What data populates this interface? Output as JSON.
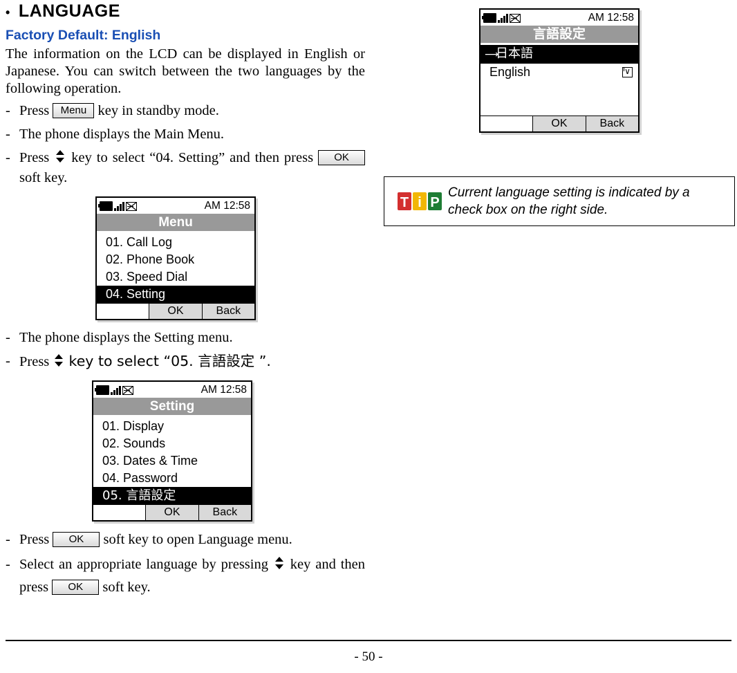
{
  "page": {
    "footer": "- 50 -"
  },
  "left": {
    "heading": "LANGUAGE",
    "subheading": "Factory Default: English",
    "intro": "The information on the LCD can be displayed in English or Japanese. You can switch between the two languages by the following operation.",
    "steps": {
      "s1_pre": "Press",
      "s1_key": "Menu",
      "s1_post": "key in standby mode.",
      "s2": "The phone displays the Main Menu.",
      "s3_pre": "Press",
      "s3_mid": "key to select “04. Setting” and then press",
      "s3_key": "OK",
      "s3_post": "soft key.",
      "s4": "The phone displays the Setting menu.",
      "s5_pre": "Press",
      "s5_post": "key to select “05. 言語設定 ”.",
      "s6_pre": "Press",
      "s6_key": "OK",
      "s6_post": "soft key to open Language menu.",
      "s7_pre": "Select an appropriate language by pressing",
      "s7_mid": "key and then press",
      "s7_key": "OK",
      "s7_post": "soft key."
    },
    "menu_screen": {
      "clock": "AM 12:58",
      "title": "Menu",
      "items": [
        "01. Call Log",
        "02. Phone Book",
        "03. Speed Dial",
        "04. Setting"
      ],
      "selected_index": 3,
      "softkeys": [
        "",
        "OK",
        "Back"
      ]
    },
    "setting_screen": {
      "clock": "AM 12:58",
      "title": "Setting",
      "items": [
        "01. Display",
        "02. Sounds",
        "03. Dates & Time",
        "04. Password",
        "05. 言語設定"
      ],
      "selected_index": 4,
      "softkeys": [
        "",
        "OK",
        "Back"
      ]
    }
  },
  "right": {
    "language_screen": {
      "clock": "AM 12:58",
      "title": "言語設定",
      "items": [
        "日本語",
        "English"
      ],
      "selected_index": 0,
      "checked_index": 1,
      "check_glyph": "∨",
      "softkeys": [
        "",
        "OK",
        "Back"
      ]
    },
    "tip": {
      "logo": "TiP",
      "text": "Current language setting is indicated by a check box on the right side."
    }
  }
}
